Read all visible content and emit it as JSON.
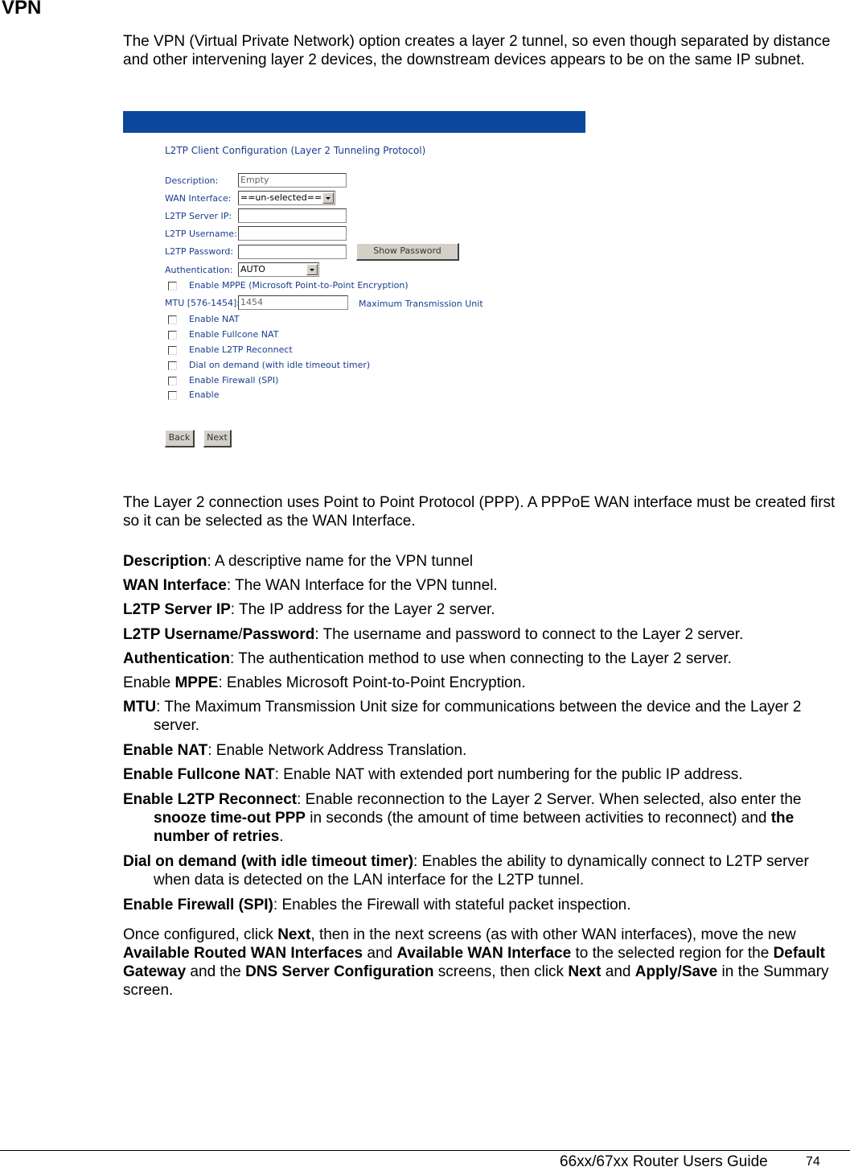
{
  "heading": "VPN",
  "intro": "The VPN (Virtual Private Network) option creates a layer 2 tunnel, so even though separated by distance and other intervening layer 2 devices, the downstream devices appears to be on the same IP subnet.",
  "screenshot": {
    "banner_color": "#0b489c",
    "title": "L2TP Client Configuration (Layer 2 Tunneling Protocol)",
    "fields": {
      "description": {
        "label": "Description:",
        "value": "Empty"
      },
      "wan_interface": {
        "label": "WAN Interface:",
        "value": "==un-selected=="
      },
      "server_ip": {
        "label": "L2TP Server IP:",
        "value": ""
      },
      "username": {
        "label": "L2TP Username:",
        "value": ""
      },
      "password": {
        "label": "L2TP Password:",
        "value": ""
      },
      "authentication": {
        "label": "Authentication:",
        "value": "AUTO"
      },
      "mtu": {
        "label": "MTU [576-1454]:",
        "value": "1454",
        "hint": "Maximum Transmission Unit"
      }
    },
    "show_password_label": "Show Password",
    "mppe_label": "Enable MPPE (Microsoft Point-to-Point Encryption)",
    "checkboxes": [
      {
        "label": "Enable NAT",
        "checked": false
      },
      {
        "label": "Enable Fullcone NAT",
        "checked": false
      },
      {
        "label": "Enable L2TP Reconnect",
        "checked": false
      },
      {
        "label": "Dial on demand (with idle timeout timer)",
        "checked": false
      },
      {
        "label": "Enable Firewall (SPI)",
        "checked": false
      },
      {
        "label": "Enable",
        "checked": false
      }
    ],
    "back_label": "Back",
    "next_label": "Next"
  },
  "layer2_para": "The Layer 2 connection uses Point to Point Protocol (PPP). A PPPoE WAN interface must be created first so it can be selected as the WAN Interface.",
  "definitions": [
    {
      "term": "Description",
      "text": ": A descriptive name for the VPN tunnel"
    },
    {
      "term": "WAN Interface",
      "text": ": The WAN Interface for the VPN tunnel."
    },
    {
      "term": "L2TP Server IP",
      "text": ": The IP address for the Layer 2 server."
    },
    {
      "term": "L2TP Username",
      "sep": "/",
      "term2": "Password",
      "text": ": The username and password to connect to the Layer 2 server."
    },
    {
      "term": "Authentication",
      "text": ": The authentication method to use when connecting to the Layer 2 server."
    },
    {
      "prefix": "Enable ",
      "term": "MPPE",
      "text": ": Enables Microsoft Point-to-Point Encryption."
    },
    {
      "term": "MTU",
      "text": ": The Maximum Transmission Unit size for communications between the device and the Layer 2 server."
    },
    {
      "term": "Enable NAT",
      "text": ": Enable Network Address Translation."
    },
    {
      "term": "Enable Fullcone NAT",
      "text": ": Enable NAT with extended port numbering for the public IP address."
    },
    {
      "term": "Enable L2TP Reconnect",
      "text": ": Enable reconnection to the Layer 2 Server. When selected, also enter the ",
      "b2": "snooze time-out PPP",
      "text2": " in seconds (the amount of time between activities to reconnect) and ",
      "b3": "the number of retries",
      "text3": "."
    },
    {
      "term": "Dial on demand (with idle timeout timer)",
      "text": ": Enables the ability to dynamically connect to L2TP server when data is detected on the LAN interface for the L2TP tunnel."
    },
    {
      "term": "Enable Firewall (SPI)",
      "text": ": Enables the Firewall with stateful packet inspection."
    }
  ],
  "closing": {
    "t1": "Once configured, click ",
    "b1": "Next",
    "t2": ", then in the next screens (as with other WAN interfaces), move the new ",
    "b2": "Available Routed WAN Interfaces",
    "t3": " and ",
    "b3": "Available WAN Interface",
    "t4": " to the selected region for the ",
    "b4": "Default Gateway",
    "t5": " and the ",
    "b5": "DNS Server Configuration",
    "t6": " screens, then click ",
    "b6": "Next",
    "t7": " and ",
    "b7": "Apply/Save",
    "t8": " in the Summary screen."
  },
  "footer": {
    "title": "66xx/67xx Router Users Guide",
    "page": "74"
  }
}
